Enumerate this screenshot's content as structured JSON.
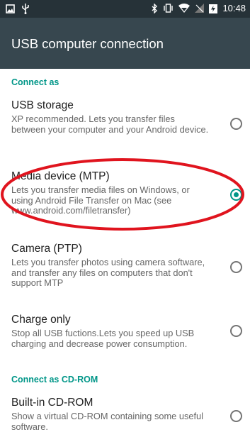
{
  "status_bar": {
    "time": "10:48",
    "icons": [
      "image-icon",
      "usb-icon",
      "bluetooth-icon",
      "vibrate-icon",
      "wifi-icon",
      "no-sim-icon",
      "battery-charging-icon"
    ]
  },
  "app_bar": {
    "title": "USB computer connection"
  },
  "sections": [
    {
      "header": "Connect as",
      "items": [
        {
          "title": "USB storage",
          "summary": "XP recommended. Lets you transfer files between your computer and your Android device.",
          "checked": false
        },
        {
          "title": "Media device (MTP)",
          "summary": "Lets you transfer media files on Windows, or using Android File Transfer on Mac (see www.android.com/filetransfer)",
          "checked": true
        },
        {
          "title": "Camera (PTP)",
          "summary": "Lets you transfer photos using camera software, and transfer any files on computers that don't support MTP",
          "checked": false
        },
        {
          "title": "Charge only",
          "summary": "Stop all USB fuctions.Lets you speed up USB charging and decrease power consumption.",
          "checked": false
        }
      ]
    },
    {
      "header": "Connect as CD-ROM",
      "items": [
        {
          "title": "Built-in CD-ROM",
          "summary": "Show a virtual CD-ROM containing some useful software.",
          "checked": false
        }
      ]
    }
  ],
  "colors": {
    "status_bar": "#263238",
    "app_bar": "#37474f",
    "accent": "#009688",
    "highlight": "#e0141e"
  }
}
